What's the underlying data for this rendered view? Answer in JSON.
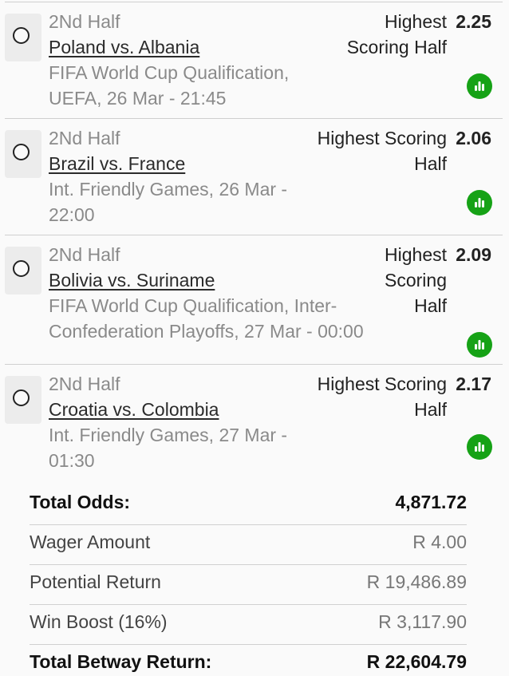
{
  "bets": [
    {
      "period": "2Nd Half",
      "match": "Poland vs. Albania",
      "info_line1": "FIFA World Cup Qualification,",
      "info_line2": "UEFA, 26 Mar - 21:45",
      "market_line1": "Highest",
      "market_line2": "Scoring Half",
      "market_line3": "",
      "odds": "2.25"
    },
    {
      "period": "2Nd Half",
      "match": "Brazil vs. France",
      "info_line1": "Int. Friendly Games, 26 Mar -",
      "info_line2": "22:00",
      "market_line1": "Highest Scoring",
      "market_line2": "Half",
      "market_line3": "",
      "odds": "2.06"
    },
    {
      "period": "2Nd Half",
      "match": "Bolivia vs. Suriname",
      "info_line1": "FIFA World Cup Qualification, Inter-",
      "info_line2": "Confederation Playoffs, 27 Mar - 00:00",
      "market_line1": "Highest",
      "market_line2": "Scoring",
      "market_line3": "Half",
      "odds": "2.09"
    },
    {
      "period": "2Nd Half",
      "match": "Croatia vs. Colombia",
      "info_line1": "Int. Friendly Games, 27 Mar -",
      "info_line2": "01:30",
      "market_line1": "Highest Scoring",
      "market_line2": "Half",
      "market_line3": "",
      "odds": "2.17"
    }
  ],
  "icons": {
    "radio": "radio-unselected-icon",
    "stats": "bar-chart-icon"
  },
  "colors": {
    "stats_icon": "#16a216"
  },
  "summary": {
    "total_odds_label": "Total Odds:",
    "total_odds_value": "4,871.72",
    "wager_label": "Wager Amount",
    "wager_value": "R 4.00",
    "potential_label": "Potential Return",
    "potential_value": "R 19,486.89",
    "boost_label": "Win Boost (16%)",
    "boost_value": "R 3,117.90",
    "total_return_label": "Total Betway Return:",
    "total_return_value": "R 22,604.79"
  }
}
